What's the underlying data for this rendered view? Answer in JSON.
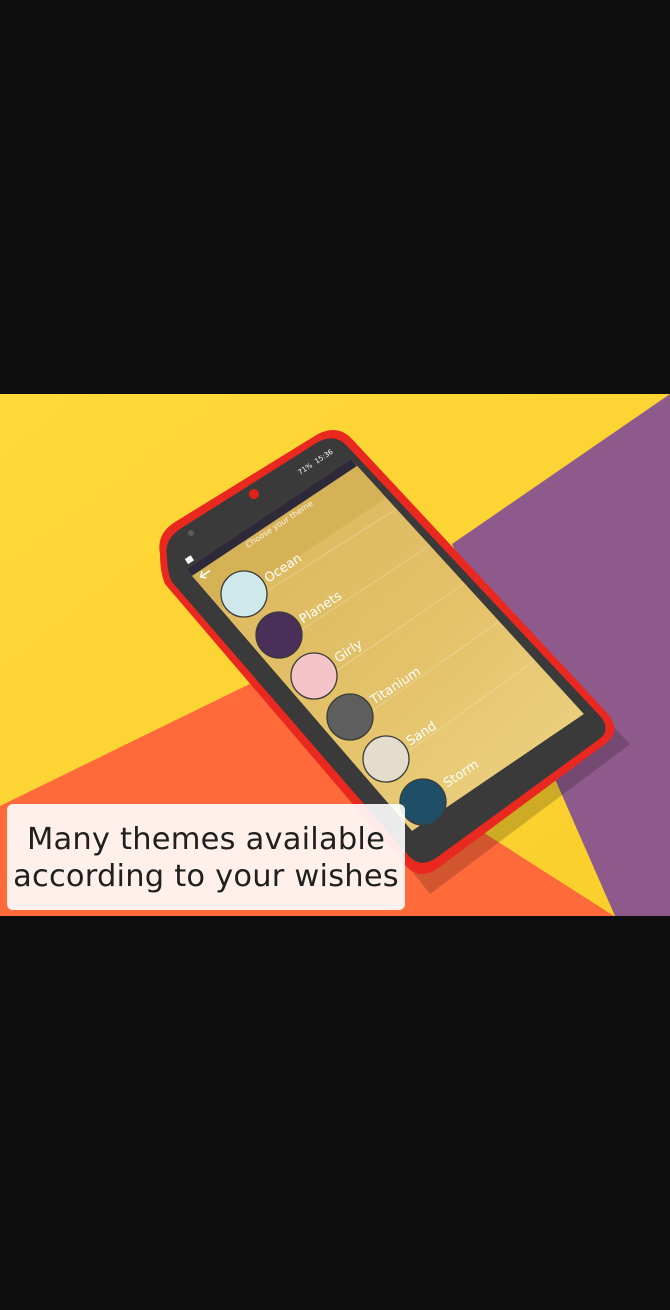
{
  "caption": {
    "line1": "Many themes available",
    "line2": "according to your wishes"
  },
  "phone": {
    "status_bar": {
      "battery": "71%",
      "time": "15:36"
    },
    "screen_title": "Choose your theme",
    "themes": [
      {
        "name": "Ocean",
        "color": "#cfe8ec"
      },
      {
        "name": "Planets",
        "color": "#4a2f58"
      },
      {
        "name": "Girly",
        "color": "#f4c4c8"
      },
      {
        "name": "Titanium",
        "color": "#5e5e5e"
      },
      {
        "name": "Sand",
        "color": "#e4dccd"
      },
      {
        "name": "Storm",
        "color": "#1f4f66"
      }
    ]
  },
  "colors": {
    "background_yellow": "#ffd632",
    "background_orange": "#ff6a3a",
    "background_purple": "#8e5a8c",
    "phone_body": "#e9281f",
    "screen_gold": "#e5c167"
  }
}
